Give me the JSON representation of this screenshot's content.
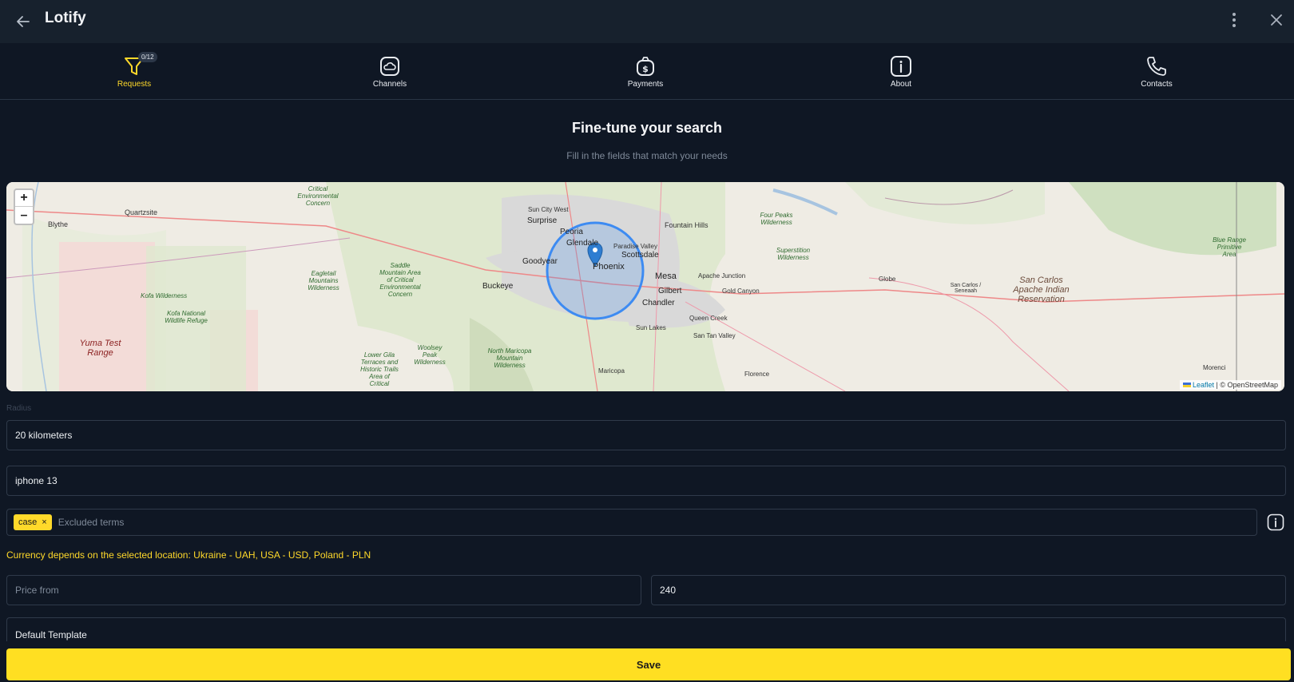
{
  "app": {
    "title": "Lotify"
  },
  "tabs": [
    {
      "label": "Requests",
      "icon": "funnel-icon",
      "badge": "0/12",
      "active": true
    },
    {
      "label": "Channels",
      "icon": "cloud-folder-icon"
    },
    {
      "label": "Payments",
      "icon": "money-bag-icon"
    },
    {
      "label": "About",
      "icon": "info-icon"
    },
    {
      "label": "Contacts",
      "icon": "phone-icon"
    }
  ],
  "heading": "Fine-tune your search",
  "subheading": "Fill in the fields that match your needs",
  "map": {
    "zoom_in": "+",
    "zoom_out": "–",
    "attribution_leaflet": "Leaflet",
    "attribution_rest": " | © OpenStreetMap",
    "labels": {
      "blythe": "Blythe",
      "quartzsite": "Quartzsite",
      "critical": "Critical Environmental Concern",
      "kofa_wild": "Kofa Wilderness",
      "kofa_ref": "Kofa National Wildlife Refuge",
      "yuma": "Yuma Test Range",
      "eagletail": "Eagletail Mountains Wilderness",
      "saddle": "Saddle Mountain Area of Critical Environmental Concern",
      "woolsey": "Woolsey Peak Wilderness",
      "lower_gila": "Lower Gila Terraces and Historic Trails Area of Critical",
      "north_maricopa": "North Maricopa Mountain Wilderness",
      "sun_city": "Sun City West",
      "surprise": "Surprise",
      "peoria": "Peoria",
      "glendale": "Glendale",
      "goodyear": "Goodyear",
      "buckeye": "Buckeye",
      "phoenix": "Phoenix",
      "paradise": "Paradise Valley",
      "scottsdale": "Scottsdale",
      "fountain": "Fountain Hills",
      "mesa": "Mesa",
      "gilbert": "Gilbert",
      "chandler": "Chandler",
      "apache_j": "Apache Junction",
      "gold_canyon": "Gold Canyon",
      "queen_creek": "Queen Creek",
      "sun_lakes": "Sun Lakes",
      "san_tan": "San Tan Valley",
      "maricopa": "Maricopa",
      "florence": "Florence",
      "four_peaks": "Four Peaks Wilderness",
      "superstition": "Superstition Wilderness",
      "globe": "Globe",
      "san_carlos": "San Carlos / Seneaah",
      "san_carlos_res": "San Carlos Apache Indian Reservation",
      "blue_range": "Blue Range Primitive Area",
      "morenci": "Morenci"
    }
  },
  "form": {
    "radius_label": "Radius",
    "radius_value": "20 kilometers",
    "keyword_value": "iphone 13",
    "excluded_chip": "case",
    "excluded_chip_remove": "×",
    "excluded_placeholder": "Excluded terms",
    "currency_note": "Currency depends on the selected location: Ukraine - UAH, USA - USD, Poland - PLN",
    "price_from_placeholder": "Price from",
    "price_to_value": "240",
    "template_value": "Default Template",
    "save_label": "Save"
  },
  "colors": {
    "accent": "#ffdf22",
    "background": "#0f1724",
    "header": "#17212d",
    "circle": "#3d8bf2"
  }
}
